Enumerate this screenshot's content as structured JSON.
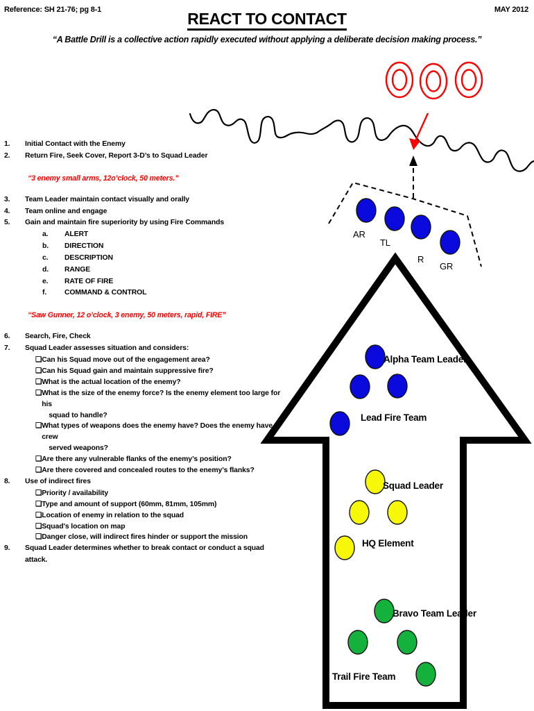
{
  "header": {
    "reference": "Reference: SH 21-76; pg 8-1",
    "title": "REACT TO CONTACT",
    "date": "MAY 2012",
    "subtitle": "“A Battle Drill is a collective action rapidly executed without applying a deliberate decision making process.”"
  },
  "quotes": {
    "contact_report": "“3 enemy small arms, 12o’clock, 50 meters.”",
    "fire_command": "“Saw Gunner, 12 o’clock, 3 enemy, 50 meters, rapid, FIRE”"
  },
  "steps": [
    {
      "num": "1.",
      "text": "Initial Contact with the Enemy"
    },
    {
      "num": "2.",
      "text": "Return Fire, Seek Cover, Report 3-D’s to Squad Leader"
    },
    {
      "num": "3.",
      "text": "Team Leader maintain contact visually and orally"
    },
    {
      "num": "4.",
      "text": "Team online and engage"
    },
    {
      "num": "5.",
      "text": "Gain and maintain fire superiority by using Fire Commands"
    },
    {
      "num": "6.",
      "text": "Search, Fire, Check"
    },
    {
      "num": "7.",
      "text": "Squad Leader assesses situation and considers:"
    },
    {
      "num": "8.",
      "text": "Use of indirect fires"
    },
    {
      "num": "9.",
      "text": "Squad Leader determines whether to break contact or conduct a squad attack."
    }
  ],
  "fire_commands": [
    {
      "letter": "a.",
      "text": "ALERT"
    },
    {
      "letter": "b.",
      "text": "DIRECTION"
    },
    {
      "letter": "c.",
      "text": "DESCRIPTION"
    },
    {
      "letter": "d.",
      "text": "RANGE"
    },
    {
      "letter": "e.",
      "text": "RATE OF FIRE"
    },
    {
      "letter": "f.",
      "text": "COMMAND & CONTROL"
    }
  ],
  "considerations": [
    {
      "text": "Can his Squad move out of the engagement area?",
      "cont": ""
    },
    {
      "text": "Can his Squad gain and maintain suppressive fire?",
      "cont": ""
    },
    {
      "text": "What is the actual location of the enemy?",
      "cont": ""
    },
    {
      "text": "What is the size of the enemy force? Is the enemy element too large for his",
      "cont": "squad to handle?"
    },
    {
      "text": "What types of weapons does the enemy have? Does the enemy have crew",
      "cont": "served weapons?"
    },
    {
      "text": "Are there any vulnerable flanks of the enemy’s position?",
      "cont": ""
    },
    {
      "text": "Are there covered and concealed routes to the enemy’s flanks?",
      "cont": ""
    }
  ],
  "indirect_fires": [
    {
      "text": "Priority / availability",
      "cont": ""
    },
    {
      "text": "Type and amount of support (60mm, 81mm, 105mm)",
      "cont": ""
    },
    {
      "text": "Location of enemy in relation to the squad",
      "cont": ""
    },
    {
      "text": "Squad's location on map",
      "cont": ""
    },
    {
      "text": "Danger close, will indirect fires hinder or support the mission",
      "cont": ""
    }
  ],
  "bullet_glyph": "❑",
  "diagram": {
    "lead_team_positions": [
      {
        "label": "AR"
      },
      {
        "label": "TL"
      },
      {
        "label": "R"
      },
      {
        "label": "GR"
      }
    ],
    "labels": {
      "alpha_team_leader": "Alpha Team Leader",
      "lead_fire_team": "Lead Fire Team",
      "squad_leader": "Squad Leader",
      "hq_element": "HQ Element",
      "bravo_team_leader": "Bravo Team Leader",
      "trail_fire_team": "Trail Fire Team"
    },
    "colors": {
      "alpha": "#0A0ADC",
      "hq": "#F7F70A",
      "bravo": "#14B23C",
      "enemy": "#FF0000",
      "terrain": "#000000"
    },
    "enemy_symbol_count": 3
  }
}
